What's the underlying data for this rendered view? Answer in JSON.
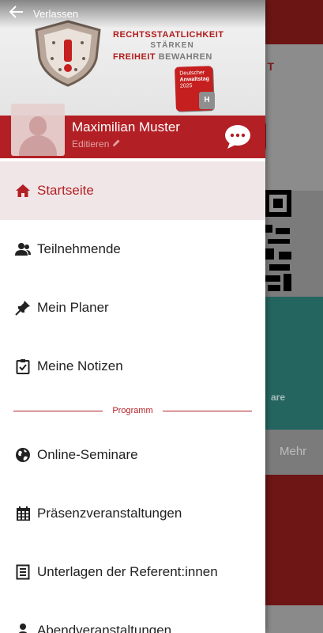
{
  "background": {
    "hero_text": "T",
    "teal_text": "are",
    "more_label": "Mehr"
  },
  "header": {
    "back_label": "Verlassen",
    "logo": {
      "line1": "RECHTSSTAATLICHKEIT",
      "line2": "STÄRKEN",
      "line3_red": "FREIHEIT",
      "line3_grey": "BEWAHREN"
    },
    "badge": {
      "line1": "Deutscher",
      "line2": "Anwaltstag",
      "line3": "2025"
    },
    "user_name": "Maximilian Muster",
    "edit_label": "Editieren"
  },
  "menu": {
    "items": [
      {
        "label": "Startseite",
        "icon": "home-icon",
        "active": true
      },
      {
        "label": "Teilnehmende",
        "icon": "people-icon",
        "active": false
      },
      {
        "label": "Mein Planer",
        "icon": "pin-icon",
        "active": false
      },
      {
        "label": "Meine Notizen",
        "icon": "clipboard-check-icon",
        "active": false
      }
    ],
    "section_title": "Programm",
    "program_items": [
      {
        "label": "Online-Seminare",
        "icon": "globe-icon"
      },
      {
        "label": "Präsenzveranstaltungen",
        "icon": "calendar-icon"
      },
      {
        "label": "Unterlagen der Referent:innen",
        "icon": "document-icon"
      },
      {
        "label": "Abendveranstaltungen",
        "icon": "person-icon"
      }
    ]
  },
  "colors": {
    "brand_red": "#b21f24",
    "active_bg": "#f1e6e7",
    "teal": "#246560"
  }
}
